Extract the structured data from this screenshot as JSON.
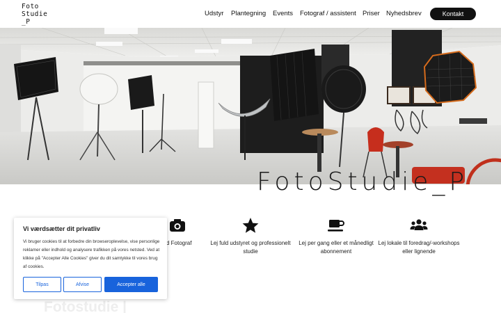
{
  "header": {
    "logo": {
      "line1": "Foto",
      "line2": "Studie",
      "line3": "_P"
    },
    "nav": [
      {
        "label": "Udstyr"
      },
      {
        "label": "Plantegning"
      },
      {
        "label": "Events"
      },
      {
        "label": "Fotograf / assistent"
      },
      {
        "label": "Priser"
      },
      {
        "label": "Nyhedsbrev"
      }
    ],
    "cta_label": "Kontakt"
  },
  "hero": {
    "title": "FotoStudie_P"
  },
  "features": [
    {
      "icon": "camera-icon",
      "text": "ed Fotograf"
    },
    {
      "icon": "star-icon",
      "text": "Lej fuld udstyret og professionelt studie"
    },
    {
      "icon": "coffee-cup-icon",
      "text": "Lej per gang eller et månedligt abonnement"
    },
    {
      "icon": "users-icon",
      "text": "Lej lokale til foredrag/-workshops eller lignende"
    }
  ],
  "section_heading": "Fotostudie |",
  "cookie_banner": {
    "title": "Vi værdsætter dit privatliv",
    "body": "Vi bruger cookies til at forbedre din browseroplevelse, vise personlige reklamer eller indhold og analysere trafikken på vores netsted. Ved at klikke på \"Accepter Alle Cookies\" giver du dit samtykke til vores brug af cookies.",
    "customize_label": "Tilpas",
    "reject_label": "Afvise",
    "accept_label": "Accepter alle"
  },
  "colors": {
    "accent": "#1863dc",
    "cta": "#111111"
  }
}
